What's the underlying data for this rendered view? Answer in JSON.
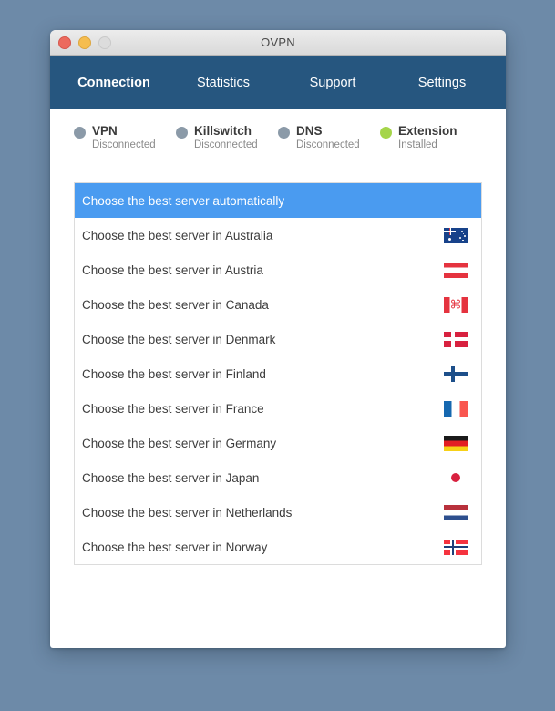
{
  "window": {
    "title": "OVPN"
  },
  "titlebar": {
    "close_label": "close",
    "minimize_label": "minimize",
    "zoom_label": "zoom"
  },
  "nav": {
    "tabs": [
      {
        "label": "Connection",
        "active": true
      },
      {
        "label": "Statistics",
        "active": false
      },
      {
        "label": "Support",
        "active": false
      },
      {
        "label": "Settings",
        "active": false
      }
    ]
  },
  "status": {
    "items": [
      {
        "label": "VPN",
        "state": "Disconnected",
        "color": "#8b9aa8"
      },
      {
        "label": "Killswitch",
        "state": "Disconnected",
        "color": "#8b9aa8"
      },
      {
        "label": "DNS",
        "state": "Disconnected",
        "color": "#8b9aa8"
      },
      {
        "label": "Extension",
        "state": "Installed",
        "color": "#a5d54a"
      }
    ]
  },
  "server_list": {
    "rows": [
      {
        "text": "Choose the best server automatically",
        "flag": "",
        "selected": true
      },
      {
        "text": "Choose the best server in Australia",
        "flag": "au",
        "selected": false
      },
      {
        "text": "Choose the best server in Austria",
        "flag": "at",
        "selected": false
      },
      {
        "text": "Choose the best server in Canada",
        "flag": "ca",
        "selected": false
      },
      {
        "text": "Choose the best server in Denmark",
        "flag": "dk",
        "selected": false
      },
      {
        "text": "Choose the best server in Finland",
        "flag": "fi",
        "selected": false
      },
      {
        "text": "Choose the best server in France",
        "flag": "fr",
        "selected": false
      },
      {
        "text": "Choose the best server in Germany",
        "flag": "de",
        "selected": false
      },
      {
        "text": "Choose the best server in Japan",
        "flag": "jp",
        "selected": false
      },
      {
        "text": "Choose the best server in Netherlands",
        "flag": "nl",
        "selected": false
      },
      {
        "text": "Choose the best server in Norway",
        "flag": "no",
        "selected": false
      }
    ],
    "canada_leaf_glyph": "⌘"
  },
  "colors": {
    "navbar": "#26567f",
    "selection": "#4a9bf0",
    "desktop": "#6d8aa8"
  }
}
